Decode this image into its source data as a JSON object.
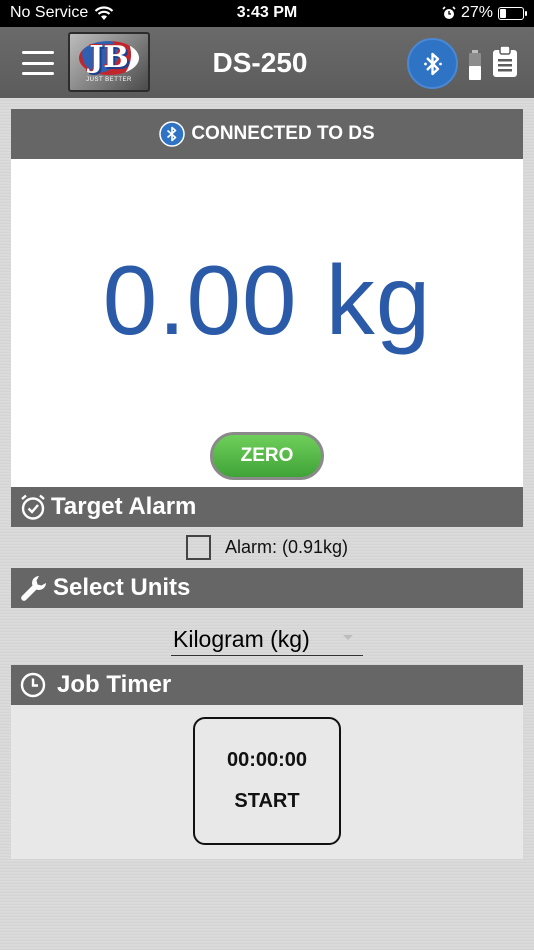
{
  "status_bar": {
    "carrier": "No Service",
    "time": "3:43 PM",
    "battery_percent": "27%",
    "battery_level": 0.27,
    "icons": [
      "wifi-icon",
      "alarm-clock-icon",
      "battery-icon"
    ]
  },
  "header": {
    "title": "DS-250",
    "logo_letters": "JB",
    "logo_tagline": "JUST BETTER",
    "icons": [
      "hamburger-menu-icon",
      "bluetooth-icon",
      "battery-level-icon",
      "clipboard-icon"
    ],
    "bluetooth_color": "#2f73c4"
  },
  "connection": {
    "status": "CONNECTED TO DS"
  },
  "scale": {
    "reading": "0.00 kg",
    "zero_label": "ZERO",
    "reading_color": "#2a5aa8",
    "zero_color": "#4fb844"
  },
  "target_alarm": {
    "title": "Target Alarm",
    "checkbox_label": "Alarm: (0.91kg)",
    "checked": false
  },
  "units": {
    "title": "Select Units",
    "selected": "Kilogram (kg)"
  },
  "job_timer": {
    "title": "Job Timer",
    "time": "00:00:00",
    "button_label": "START"
  }
}
